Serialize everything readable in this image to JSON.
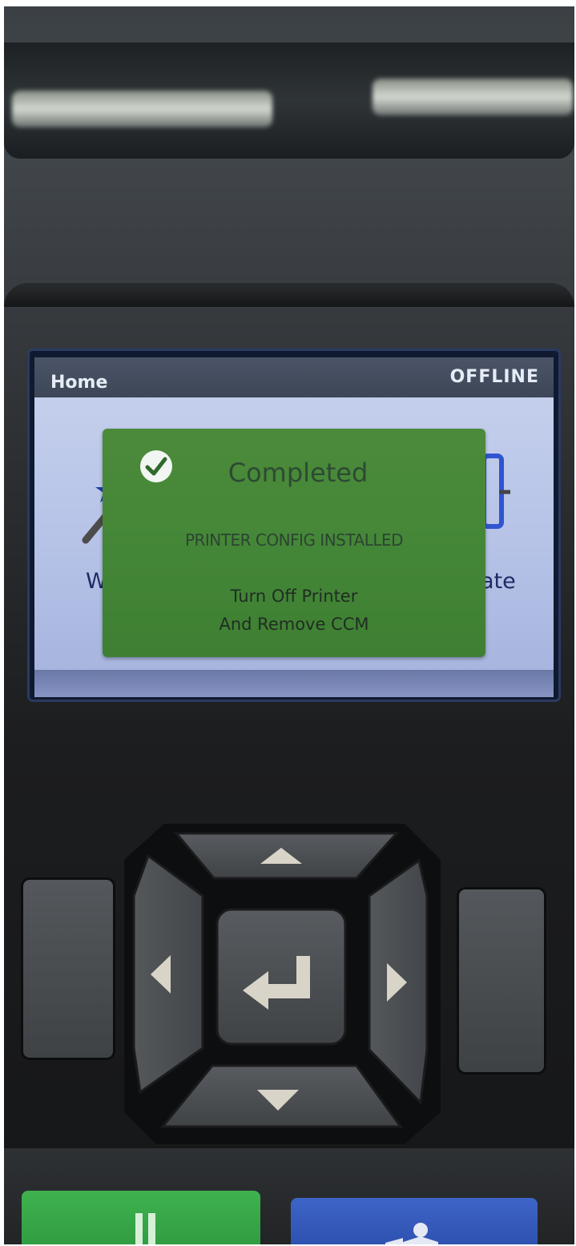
{
  "screen": {
    "header": {
      "title": "Home",
      "status": "OFFLINE"
    },
    "background_labels": {
      "left_fragment": "W",
      "right_fragment": "ate"
    },
    "dialog": {
      "title": "Completed",
      "status_message": "PRINTER CONFIG INSTALLED",
      "instruction_line1": "Turn Off Printer",
      "instruction_line2": "And Remove CCM",
      "icon": "check-circle-icon"
    }
  },
  "keypad": {
    "icons": [
      "up-arrow-icon",
      "down-arrow-icon",
      "left-arrow-icon",
      "right-arrow-icon",
      "enter-icon"
    ]
  },
  "colors": {
    "dialog_green": "#468838",
    "pause_button_green": "#3fb24f",
    "cancel_button_blue": "#3d64c8"
  }
}
